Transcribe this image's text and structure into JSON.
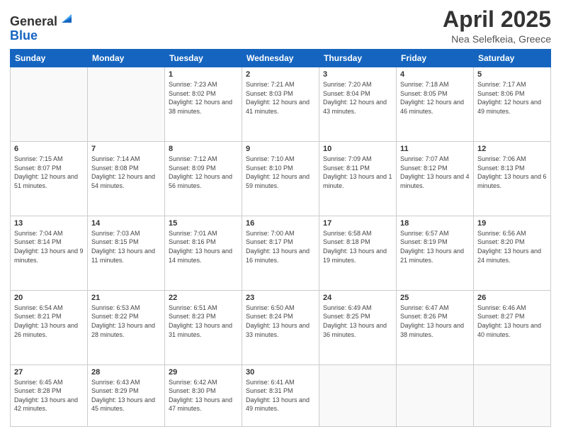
{
  "header": {
    "logo_general": "General",
    "logo_blue": "Blue",
    "title": "April 2025",
    "location": "Nea Selefkeia, Greece"
  },
  "days_of_week": [
    "Sunday",
    "Monday",
    "Tuesday",
    "Wednesday",
    "Thursday",
    "Friday",
    "Saturday"
  ],
  "weeks": [
    [
      {
        "day": "",
        "info": ""
      },
      {
        "day": "",
        "info": ""
      },
      {
        "day": "1",
        "info": "Sunrise: 7:23 AM\nSunset: 8:02 PM\nDaylight: 12 hours and 38 minutes."
      },
      {
        "day": "2",
        "info": "Sunrise: 7:21 AM\nSunset: 8:03 PM\nDaylight: 12 hours and 41 minutes."
      },
      {
        "day": "3",
        "info": "Sunrise: 7:20 AM\nSunset: 8:04 PM\nDaylight: 12 hours and 43 minutes."
      },
      {
        "day": "4",
        "info": "Sunrise: 7:18 AM\nSunset: 8:05 PM\nDaylight: 12 hours and 46 minutes."
      },
      {
        "day": "5",
        "info": "Sunrise: 7:17 AM\nSunset: 8:06 PM\nDaylight: 12 hours and 49 minutes."
      }
    ],
    [
      {
        "day": "6",
        "info": "Sunrise: 7:15 AM\nSunset: 8:07 PM\nDaylight: 12 hours and 51 minutes."
      },
      {
        "day": "7",
        "info": "Sunrise: 7:14 AM\nSunset: 8:08 PM\nDaylight: 12 hours and 54 minutes."
      },
      {
        "day": "8",
        "info": "Sunrise: 7:12 AM\nSunset: 8:09 PM\nDaylight: 12 hours and 56 minutes."
      },
      {
        "day": "9",
        "info": "Sunrise: 7:10 AM\nSunset: 8:10 PM\nDaylight: 12 hours and 59 minutes."
      },
      {
        "day": "10",
        "info": "Sunrise: 7:09 AM\nSunset: 8:11 PM\nDaylight: 13 hours and 1 minute."
      },
      {
        "day": "11",
        "info": "Sunrise: 7:07 AM\nSunset: 8:12 PM\nDaylight: 13 hours and 4 minutes."
      },
      {
        "day": "12",
        "info": "Sunrise: 7:06 AM\nSunset: 8:13 PM\nDaylight: 13 hours and 6 minutes."
      }
    ],
    [
      {
        "day": "13",
        "info": "Sunrise: 7:04 AM\nSunset: 8:14 PM\nDaylight: 13 hours and 9 minutes."
      },
      {
        "day": "14",
        "info": "Sunrise: 7:03 AM\nSunset: 8:15 PM\nDaylight: 13 hours and 11 minutes."
      },
      {
        "day": "15",
        "info": "Sunrise: 7:01 AM\nSunset: 8:16 PM\nDaylight: 13 hours and 14 minutes."
      },
      {
        "day": "16",
        "info": "Sunrise: 7:00 AM\nSunset: 8:17 PM\nDaylight: 13 hours and 16 minutes."
      },
      {
        "day": "17",
        "info": "Sunrise: 6:58 AM\nSunset: 8:18 PM\nDaylight: 13 hours and 19 minutes."
      },
      {
        "day": "18",
        "info": "Sunrise: 6:57 AM\nSunset: 8:19 PM\nDaylight: 13 hours and 21 minutes."
      },
      {
        "day": "19",
        "info": "Sunrise: 6:56 AM\nSunset: 8:20 PM\nDaylight: 13 hours and 24 minutes."
      }
    ],
    [
      {
        "day": "20",
        "info": "Sunrise: 6:54 AM\nSunset: 8:21 PM\nDaylight: 13 hours and 26 minutes."
      },
      {
        "day": "21",
        "info": "Sunrise: 6:53 AM\nSunset: 8:22 PM\nDaylight: 13 hours and 28 minutes."
      },
      {
        "day": "22",
        "info": "Sunrise: 6:51 AM\nSunset: 8:23 PM\nDaylight: 13 hours and 31 minutes."
      },
      {
        "day": "23",
        "info": "Sunrise: 6:50 AM\nSunset: 8:24 PM\nDaylight: 13 hours and 33 minutes."
      },
      {
        "day": "24",
        "info": "Sunrise: 6:49 AM\nSunset: 8:25 PM\nDaylight: 13 hours and 36 minutes."
      },
      {
        "day": "25",
        "info": "Sunrise: 6:47 AM\nSunset: 8:26 PM\nDaylight: 13 hours and 38 minutes."
      },
      {
        "day": "26",
        "info": "Sunrise: 6:46 AM\nSunset: 8:27 PM\nDaylight: 13 hours and 40 minutes."
      }
    ],
    [
      {
        "day": "27",
        "info": "Sunrise: 6:45 AM\nSunset: 8:28 PM\nDaylight: 13 hours and 42 minutes."
      },
      {
        "day": "28",
        "info": "Sunrise: 6:43 AM\nSunset: 8:29 PM\nDaylight: 13 hours and 45 minutes."
      },
      {
        "day": "29",
        "info": "Sunrise: 6:42 AM\nSunset: 8:30 PM\nDaylight: 13 hours and 47 minutes."
      },
      {
        "day": "30",
        "info": "Sunrise: 6:41 AM\nSunset: 8:31 PM\nDaylight: 13 hours and 49 minutes."
      },
      {
        "day": "",
        "info": ""
      },
      {
        "day": "",
        "info": ""
      },
      {
        "day": "",
        "info": ""
      }
    ]
  ]
}
